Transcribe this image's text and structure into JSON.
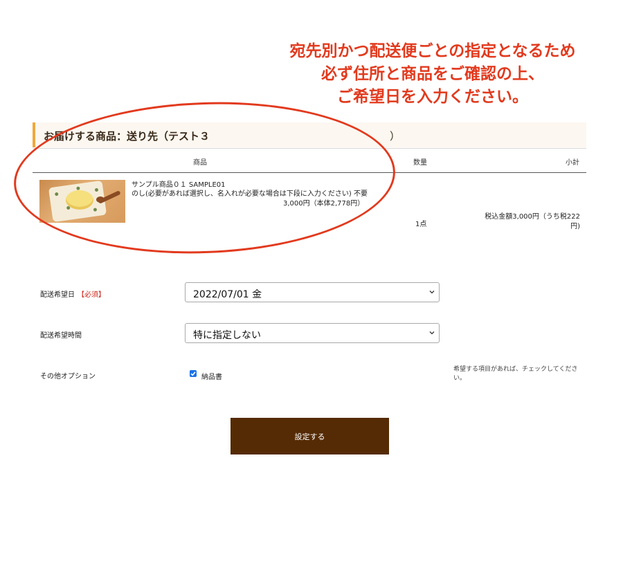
{
  "annotation": {
    "lines": [
      "宛先別かつ配送便ごとの指定となるため",
      "必ず住所と商品をご確認の上、",
      "ご希望日を入力ください。"
    ],
    "color": "#e23a1e"
  },
  "section": {
    "title": "お届けする商品：送り先（テスト３",
    "close_paren": "）"
  },
  "table": {
    "headers": {
      "product": "商品",
      "qty": "数量",
      "subtotal": "小計"
    },
    "row": {
      "image_icon": "product-photo",
      "name": "サンプル商品０１ SAMPLE01",
      "noshi": "のし(必要があれば選択し、名入れが必要な場合は下段に入力ください) 不要",
      "price": "3,000円（本体2,778円）",
      "qty": "1点",
      "subtotal": "税込金額3,000円（うち税222円)"
    }
  },
  "form": {
    "date": {
      "label": "配送希望日",
      "required": "【必須】",
      "value": "2022/07/01 金"
    },
    "time": {
      "label": "配送希望時間",
      "value": "特に指定しない"
    },
    "options": {
      "label": "その他オプション",
      "checkbox_label": "納品書",
      "checked": true,
      "help": "希望する項目があれば、チェックしてください。"
    }
  },
  "submit_label": "設定する",
  "colors": {
    "accent": "#f0a83a",
    "header_bg": "#fcf7f0",
    "button": "#552b05",
    "required": "#d0281e",
    "checkbox": "#1a73e8"
  }
}
